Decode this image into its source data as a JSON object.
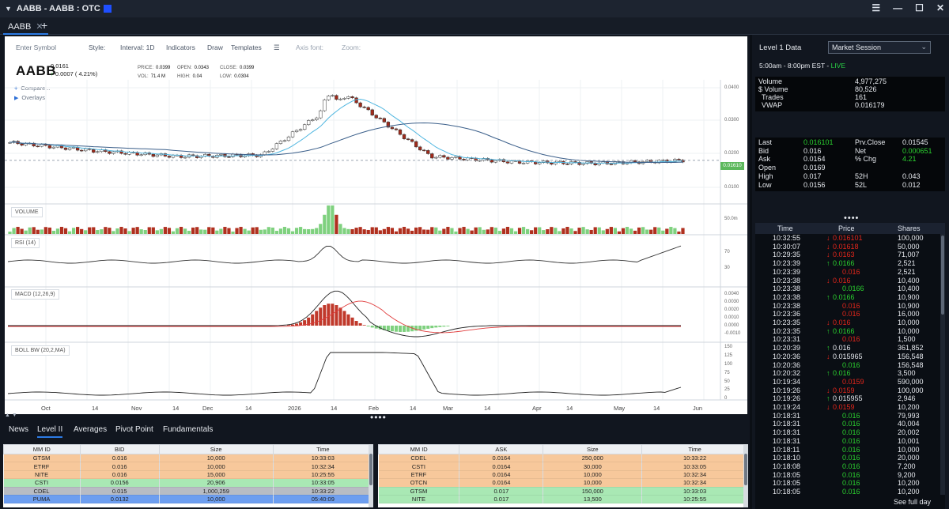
{
  "window": {
    "title": "AABB - AABB : OTC",
    "accent": "#1f4fff"
  },
  "tabs": [
    {
      "label": "AABB"
    }
  ],
  "toolbar": {
    "symbol_placeholder": "Enter Symbol",
    "style": "Style:",
    "interval": "Interval: 1D",
    "indicators": "Indicators",
    "draw": "Draw",
    "templates": "Templates",
    "axis_font": "Axis font:",
    "zoom": "Zoom:"
  },
  "quote": {
    "symbol": "AABB",
    "price": "0.0161",
    "change": "0.0007 ( 4.21%)",
    "price_label": "PRICE:",
    "price_val": "0.0399",
    "open_label": "OPEN:",
    "open_val": "0.0343",
    "close_label": "CLOSE:",
    "close_val": "0.0399",
    "vol_label": "VOL:",
    "vol_val": "71.4 M",
    "high_label": "HIGH:",
    "high_val": "0.04",
    "low_label": "LOW:",
    "low_val": "0.0304"
  },
  "chart_links": {
    "compare": "Compare...",
    "overlays": "Overlays"
  },
  "panels": {
    "volume": "VOLUME",
    "rsi": "RSI (14)",
    "macd": "MACD (12,26,9)",
    "boll": "BOLL BW (20,2,MA)"
  },
  "price_axis": [
    "0.0400",
    "0.0300",
    "0.0200",
    "0.0100"
  ],
  "last_tag": "0.01610",
  "volume_axis": "50.0m",
  "rsi_axis": [
    "70",
    "30"
  ],
  "macd_axis": [
    "0.0040",
    "0.0030",
    "0.0020",
    "0.0010",
    "0.0000",
    "-0.0010"
  ],
  "boll_axis": [
    "150",
    "125",
    "100",
    "75",
    "50",
    "25",
    "0"
  ],
  "x_axis": [
    "Oct",
    "14",
    "Nov",
    "14",
    "Dec",
    "14",
    "2026",
    "14",
    "Feb",
    "14",
    "Mar",
    "14",
    "Apr",
    "14",
    "May",
    "14",
    "Jun"
  ],
  "chart_data": {
    "type": "line",
    "title": "AABB",
    "x": [
      "Oct",
      "Nov",
      "Dec",
      "2026",
      "Feb",
      "Mar",
      "Apr",
      "May",
      "Jun"
    ],
    "series": [
      {
        "name": "AABB",
        "values": [
          0.0225,
          0.0195,
          0.0175,
          0.018,
          0.0395,
          0.0175,
          0.0155,
          0.015,
          0.0161
        ]
      }
    ],
    "ylim": [
      0.005,
      0.045
    ]
  },
  "bottom_tabs": [
    "News",
    "Level II",
    "Averages",
    "Pivot Point",
    "Fundamentals"
  ],
  "level2": {
    "bid_headers": [
      "MM ID",
      "BID",
      "Size",
      "Time"
    ],
    "bid_rows": [
      [
        "GTSM",
        "0.016",
        "10,000",
        "10:33:03"
      ],
      [
        "ETRF",
        "0.016",
        "10,000",
        "10:32:34"
      ],
      [
        "NITE",
        "0.016",
        "15,000",
        "10:25:55"
      ],
      [
        "CSTI",
        "0.0156",
        "20,906",
        "10:33:05"
      ],
      [
        "CDEL",
        "0.015",
        "1,000,259",
        "10:33:22"
      ],
      [
        "PUMA",
        "0.0132",
        "10,000",
        "05:40:09"
      ]
    ],
    "ask_headers": [
      "MM ID",
      "ASK",
      "Size",
      "Time"
    ],
    "ask_rows": [
      [
        "CDEL",
        "0.0164",
        "250,000",
        "10:33:22"
      ],
      [
        "CSTI",
        "0.0164",
        "30,000",
        "10:33:05"
      ],
      [
        "ETRF",
        "0.0164",
        "10,000",
        "10:32:34"
      ],
      [
        "OTCN",
        "0.0164",
        "10,000",
        "10:32:34"
      ],
      [
        "GTSM",
        "0.017",
        "150,000",
        "10:33:03"
      ],
      [
        "NITE",
        "0.017",
        "13,500",
        "10:25:55"
      ]
    ],
    "row_colors": [
      "#f7c89b",
      "#f7c89b",
      "#f7c89b",
      "#a9e8b4",
      "#b8bcc4",
      "#6d9ef0"
    ],
    "ask_row_colors": [
      "#f7c89b",
      "#f7c89b",
      "#f7c89b",
      "#f7c89b",
      "#a9e8b4",
      "#a9e8b4"
    ]
  },
  "level1": {
    "heading": "Level 1 Data",
    "session": "Market Session",
    "hours": "5:00am - 8:00pm EST - ",
    "live": "LIVE",
    "volume": [
      [
        "Volume",
        "4,977,275"
      ],
      [
        "$ Volume",
        "80,526"
      ],
      [
        "Trades",
        "161"
      ],
      [
        "VWAP",
        "0.016179"
      ]
    ],
    "quote_left": [
      [
        "Last",
        "0.016101"
      ],
      [
        "Bid",
        "0.016"
      ],
      [
        "Ask",
        "0.0164"
      ],
      [
        "Open",
        "0.0169"
      ],
      [
        "High",
        "0.017"
      ],
      [
        "Low",
        "0.0156"
      ]
    ],
    "quote_right": [
      [
        "Prv.Close",
        "0.01545"
      ],
      [
        "Net",
        "0.000651"
      ],
      [
        "% Chg",
        "4.21"
      ],
      [
        "",
        ""
      ],
      [
        "52H",
        "0.043"
      ],
      [
        "52L",
        "0.012"
      ]
    ]
  },
  "time_sales": {
    "headers": [
      "Time",
      "Price",
      "Shares"
    ],
    "rows": [
      [
        "10:32:55",
        "0.016101",
        "100,000",
        "down"
      ],
      [
        "10:30:07",
        "0.01618",
        "50,000",
        "down"
      ],
      [
        "10:29:35",
        "0.0163",
        "71,007",
        "down"
      ],
      [
        "10:23:39",
        "0.0166",
        "2,521",
        "up"
      ],
      [
        "10:23:39",
        "0.016",
        "2,521",
        "red"
      ],
      [
        "10:23:38",
        "0.016",
        "10,400",
        "down"
      ],
      [
        "10:23:38",
        "0.0166",
        "10,400",
        "green"
      ],
      [
        "10:23:38",
        "0.0166",
        "10,900",
        "up"
      ],
      [
        "10:23:38",
        "0.016",
        "10,900",
        "red"
      ],
      [
        "10:23:36",
        "0.016",
        "16,000",
        "red"
      ],
      [
        "10:23:35",
        "0.016",
        "10,000",
        "down"
      ],
      [
        "10:23:35",
        "0.0166",
        "10,000",
        "up"
      ],
      [
        "10:23:31",
        "0.016",
        "1,500",
        "red"
      ],
      [
        "10:20:39",
        "0.016",
        "361,852",
        "up-white"
      ],
      [
        "10:20:36",
        "0.015965",
        "156,548",
        "down-white"
      ],
      [
        "10:20:36",
        "0.016",
        "156,548",
        "green"
      ],
      [
        "10:20:32",
        "0.016",
        "3,500",
        "up"
      ],
      [
        "10:19:34",
        "0.0159",
        "590,000",
        "red"
      ],
      [
        "10:19:26",
        "0.0159",
        "100,000",
        "down"
      ],
      [
        "10:19:26",
        "0.015955",
        "2,946",
        "up-white"
      ],
      [
        "10:19:24",
        "0.0159",
        "10,200",
        "down"
      ],
      [
        "10:18:31",
        "0.016",
        "79,993",
        "green"
      ],
      [
        "10:18:31",
        "0.016",
        "40,004",
        "green"
      ],
      [
        "10:18:31",
        "0.016",
        "20,002",
        "green"
      ],
      [
        "10:18:31",
        "0.016",
        "10,001",
        "green"
      ],
      [
        "10:18:11",
        "0.016",
        "10,000",
        "green"
      ],
      [
        "10:18:10",
        "0.016",
        "20,000",
        "green"
      ],
      [
        "10:18:08",
        "0.016",
        "7,200",
        "green"
      ],
      [
        "10:18:05",
        "0.016",
        "9,200",
        "green"
      ],
      [
        "10:18:05",
        "0.016",
        "10,200",
        "green"
      ],
      [
        "10:18:05",
        "0.016",
        "10,200",
        "green"
      ]
    ],
    "see_full_day": "See full day"
  }
}
